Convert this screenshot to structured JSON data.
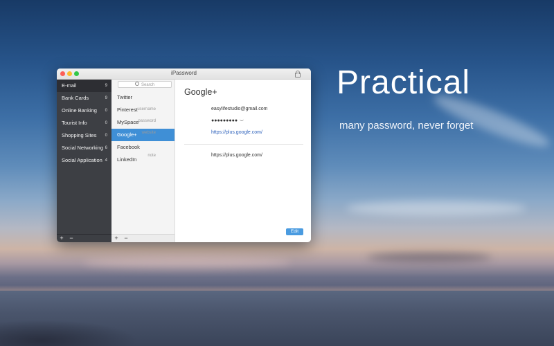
{
  "hero": {
    "title": "Practical",
    "subtitle": "many password, never forget"
  },
  "window": {
    "title": "iPassword"
  },
  "sidebar": {
    "categories": [
      {
        "label": "E-mail",
        "count": "9"
      },
      {
        "label": "Bank Cards",
        "count": "9"
      },
      {
        "label": "Online Banking",
        "count": "0"
      },
      {
        "label": "Tourist Info",
        "count": "0"
      },
      {
        "label": "Shopping Sites",
        "count": "0"
      },
      {
        "label": "Social Networking",
        "count": "6"
      },
      {
        "label": "Social Application",
        "count": "4"
      }
    ],
    "add_label": "+",
    "remove_label": "−"
  },
  "list": {
    "search_placeholder": "Search",
    "items": [
      {
        "label": "Twitter"
      },
      {
        "label": "Pinterest"
      },
      {
        "label": "MySpace"
      },
      {
        "label": "Google+"
      },
      {
        "label": "Facebook"
      },
      {
        "label": "LinkedIn"
      }
    ],
    "selected_index": 3,
    "add_label": "+",
    "remove_label": "−"
  },
  "detail": {
    "title": "Google+",
    "fields": [
      {
        "label": "username",
        "value": "easylifestudio@gmail.com"
      },
      {
        "label": "password",
        "value": "●●●●●●●●●"
      },
      {
        "label": "website",
        "value": "https://plus.google.com/"
      },
      {
        "label": "note",
        "value": "https://plus.google.com/"
      }
    ],
    "edit_label": "Edit"
  },
  "colors": {
    "accent": "#3f8fd6",
    "sidebar_bg": "#3d3f44",
    "link": "#2a5fba"
  }
}
